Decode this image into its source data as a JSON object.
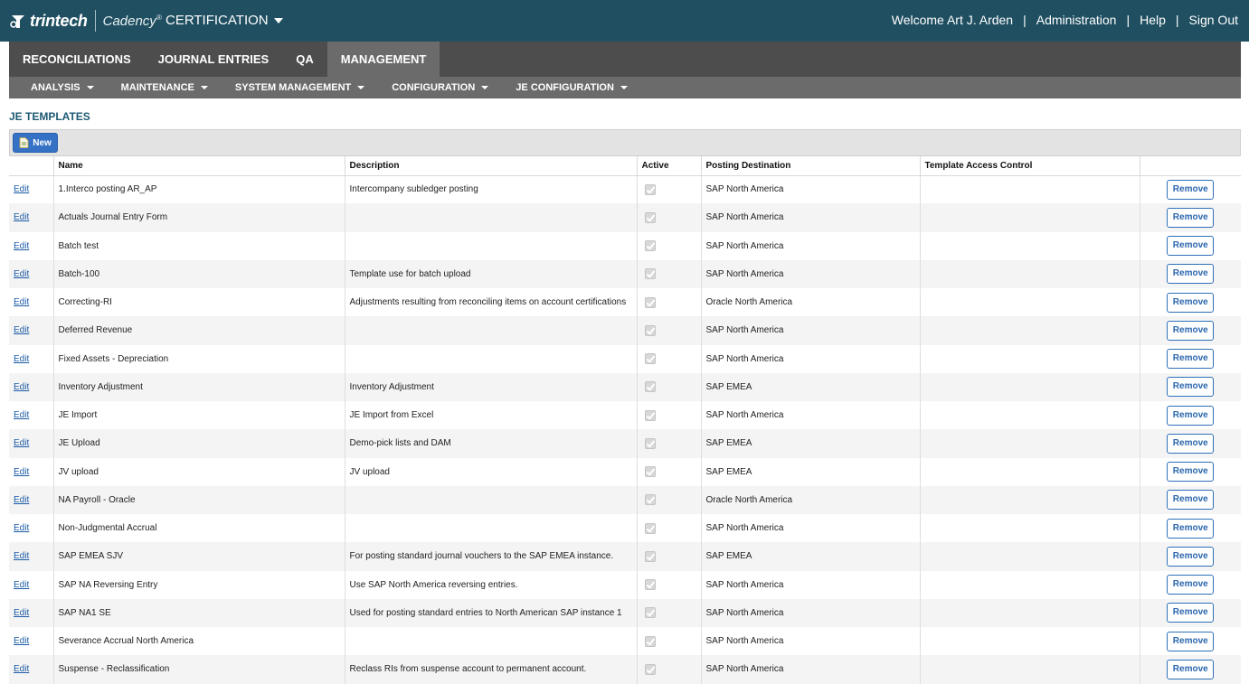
{
  "header": {
    "logo_text": "trintech",
    "product": "Cadency",
    "product_mark": "®",
    "environment": "CERTIFICATION",
    "welcome": "Welcome Art J. Arden",
    "admin_link": "Administration",
    "help_link": "Help",
    "signout_link": "Sign Out",
    "separator": "|"
  },
  "main_tabs": [
    {
      "label": "RECONCILIATIONS",
      "active": false
    },
    {
      "label": "JOURNAL ENTRIES",
      "active": false
    },
    {
      "label": "QA",
      "active": false
    },
    {
      "label": "MANAGEMENT",
      "active": true
    }
  ],
  "sub_nav": [
    {
      "label": "ANALYSIS"
    },
    {
      "label": "MAINTENANCE"
    },
    {
      "label": "SYSTEM MANAGEMENT"
    },
    {
      "label": "CONFIGURATION"
    },
    {
      "label": "JE CONFIGURATION"
    }
  ],
  "page_title": "JE TEMPLATES",
  "toolbar": {
    "new_label": "New"
  },
  "table": {
    "columns": [
      "",
      "Name",
      "Description",
      "Active",
      "Posting Destination",
      "Template Access Control",
      ""
    ],
    "edit_label": "Edit",
    "remove_label": "Remove",
    "rows": [
      {
        "name": "1.Interco posting AR_AP",
        "description": "Intercompany subledger posting",
        "active": true,
        "destination": "SAP North America",
        "access": ""
      },
      {
        "name": "Actuals Journal Entry Form",
        "description": "",
        "active": true,
        "destination": "SAP North America",
        "access": ""
      },
      {
        "name": "Batch test",
        "description": "",
        "active": true,
        "destination": "SAP North America",
        "access": ""
      },
      {
        "name": "Batch-100",
        "description": "Template use for batch upload",
        "active": true,
        "destination": "SAP North America",
        "access": ""
      },
      {
        "name": "Correcting-RI",
        "description": "Adjustments resulting from reconciling items on account certifications",
        "active": true,
        "destination": "Oracle North America",
        "access": ""
      },
      {
        "name": "Deferred Revenue",
        "description": "",
        "active": true,
        "destination": "SAP North America",
        "access": ""
      },
      {
        "name": "Fixed Assets - Depreciation",
        "description": "",
        "active": true,
        "destination": "SAP North America",
        "access": ""
      },
      {
        "name": "Inventory Adjustment",
        "description": "Inventory Adjustment",
        "active": true,
        "destination": "SAP EMEA",
        "access": ""
      },
      {
        "name": "JE Import",
        "description": "JE Import from Excel",
        "active": true,
        "destination": "SAP North America",
        "access": ""
      },
      {
        "name": "JE Upload",
        "description": "Demo-pick lists and DAM",
        "active": true,
        "destination": "SAP EMEA",
        "access": ""
      },
      {
        "name": "JV upload",
        "description": "JV upload",
        "active": true,
        "destination": "SAP EMEA",
        "access": ""
      },
      {
        "name": "NA Payroll - Oracle",
        "description": "",
        "active": true,
        "destination": "Oracle North America",
        "access": ""
      },
      {
        "name": "Non-Judgmental Accrual",
        "description": "",
        "active": true,
        "destination": "SAP North America",
        "access": ""
      },
      {
        "name": "SAP EMEA SJV",
        "description": "For posting standard journal vouchers to the SAP EMEA instance.",
        "active": true,
        "destination": "SAP EMEA",
        "access": ""
      },
      {
        "name": "SAP NA Reversing Entry",
        "description": "Use SAP North America reversing entries.",
        "active": true,
        "destination": "SAP North America",
        "access": ""
      },
      {
        "name": "SAP NA1 SE",
        "description": "Used for posting standard entries to North American SAP instance 1",
        "active": true,
        "destination": "SAP North America",
        "access": ""
      },
      {
        "name": "Severance Accrual North America",
        "description": "",
        "active": true,
        "destination": "SAP North America",
        "access": ""
      },
      {
        "name": "Suspense - Reclassification",
        "description": "Reclass RIs from suspense account to permanent account.",
        "active": true,
        "destination": "SAP North America",
        "access": ""
      }
    ]
  },
  "colors": {
    "header_bg": "#1f4f61",
    "tabbar_bg": "#4d4d4d",
    "active_tab_bg": "#6b6b6b",
    "title": "#1c5a74",
    "link": "#1a5aa6",
    "button_blue": "#3572c6"
  },
  "icons": {
    "logo": "trintech-logo-icon",
    "environment_dropdown": "caret-down-icon",
    "new": "new-document-icon",
    "active": "checkbox-checked-icon"
  }
}
